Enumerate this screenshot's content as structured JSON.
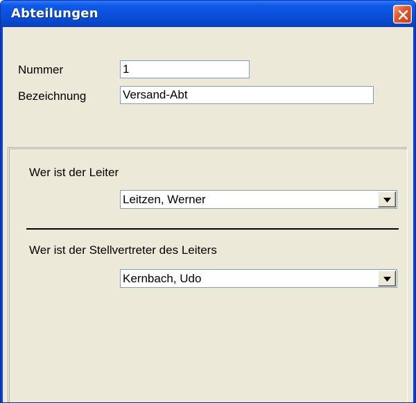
{
  "window": {
    "title": "Abteilungen"
  },
  "fields": {
    "nummer_label": "Nummer",
    "nummer_value": "1",
    "bezeichnung_label": "Bezeichnung",
    "bezeichnung_value": "Versand-Abt"
  },
  "leiter": {
    "label": "Wer ist der Leiter",
    "selected": "Leitzen, Werner"
  },
  "stellvertreter": {
    "label": "Wer ist der Stellvertreter des Leiters",
    "selected": "Kernbach, Udo"
  },
  "colors": {
    "titlebar": "#0a4fdb",
    "client_bg": "#ece9d8",
    "close_button": "#e25a30"
  },
  "icons": {
    "close": "close-icon",
    "dropdown": "chevron-down-icon"
  }
}
